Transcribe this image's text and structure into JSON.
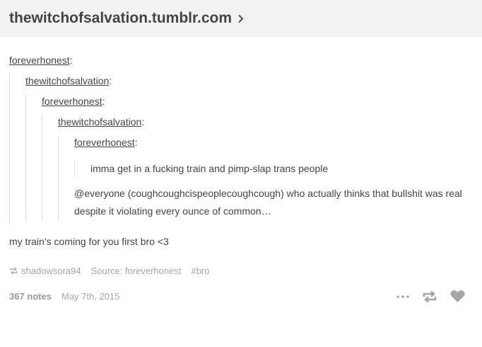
{
  "header": {
    "blog_url": "thewitchofsalvation.tumblr.com"
  },
  "thread": {
    "u1": "foreverhonest",
    "u2": "thewitchofsalvation",
    "u3": "foreverhonest",
    "u4": "thewitchofsalvation",
    "u5": "foreverhonest",
    "colon": ":",
    "quote_text": "imma get in a fucking train and pimp-slap trans people",
    "reply_text": "@everyone (coughcoughcispeoplecoughcough) who actually thinks that bullshit was real despite it violating every ounce of common…",
    "own_text": "my train’s coming for you first bro <3"
  },
  "meta": {
    "reblogged_from": "shadowsora94",
    "source": "Source: foreverhonest",
    "tag": "#bro"
  },
  "footer": {
    "notes": "367 notes",
    "date": "May 7th, 2015"
  },
  "icons": {
    "header": "chevron-right-icon",
    "meta": "reblog-small-icon",
    "actions": [
      "more-icon",
      "reblog-icon",
      "like-heart-icon"
    ]
  }
}
